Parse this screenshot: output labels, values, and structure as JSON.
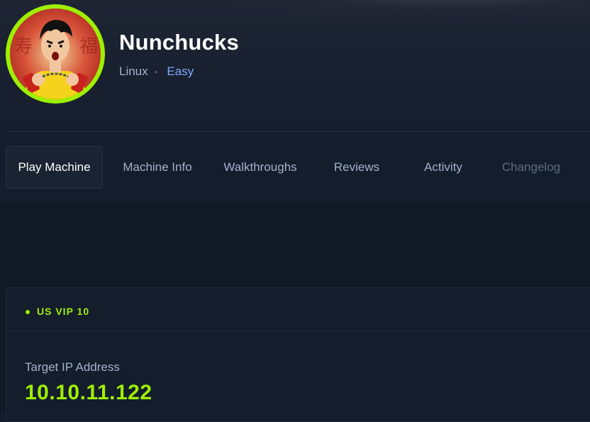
{
  "machine": {
    "name": "Nunchucks",
    "os": "Linux",
    "separator": "·",
    "difficulty": "Easy",
    "avatar_icon": "nunchucks-fighter-avatar"
  },
  "tabs": [
    {
      "label": "Play Machine",
      "state": "active"
    },
    {
      "label": "Machine Info",
      "state": "normal"
    },
    {
      "label": "Walkthroughs",
      "state": "normal"
    },
    {
      "label": "Reviews",
      "state": "normal"
    },
    {
      "label": "Activity",
      "state": "normal"
    },
    {
      "label": "Changelog",
      "state": "disabled"
    }
  ],
  "connection": {
    "server": "US VIP 10",
    "status_color": "#9fef00",
    "ip_label": "Target IP Address",
    "ip_value": "10.10.11.122"
  },
  "colors": {
    "accent": "#9fef00",
    "difficulty": "#7ea6ff",
    "background": "#141d2b"
  }
}
